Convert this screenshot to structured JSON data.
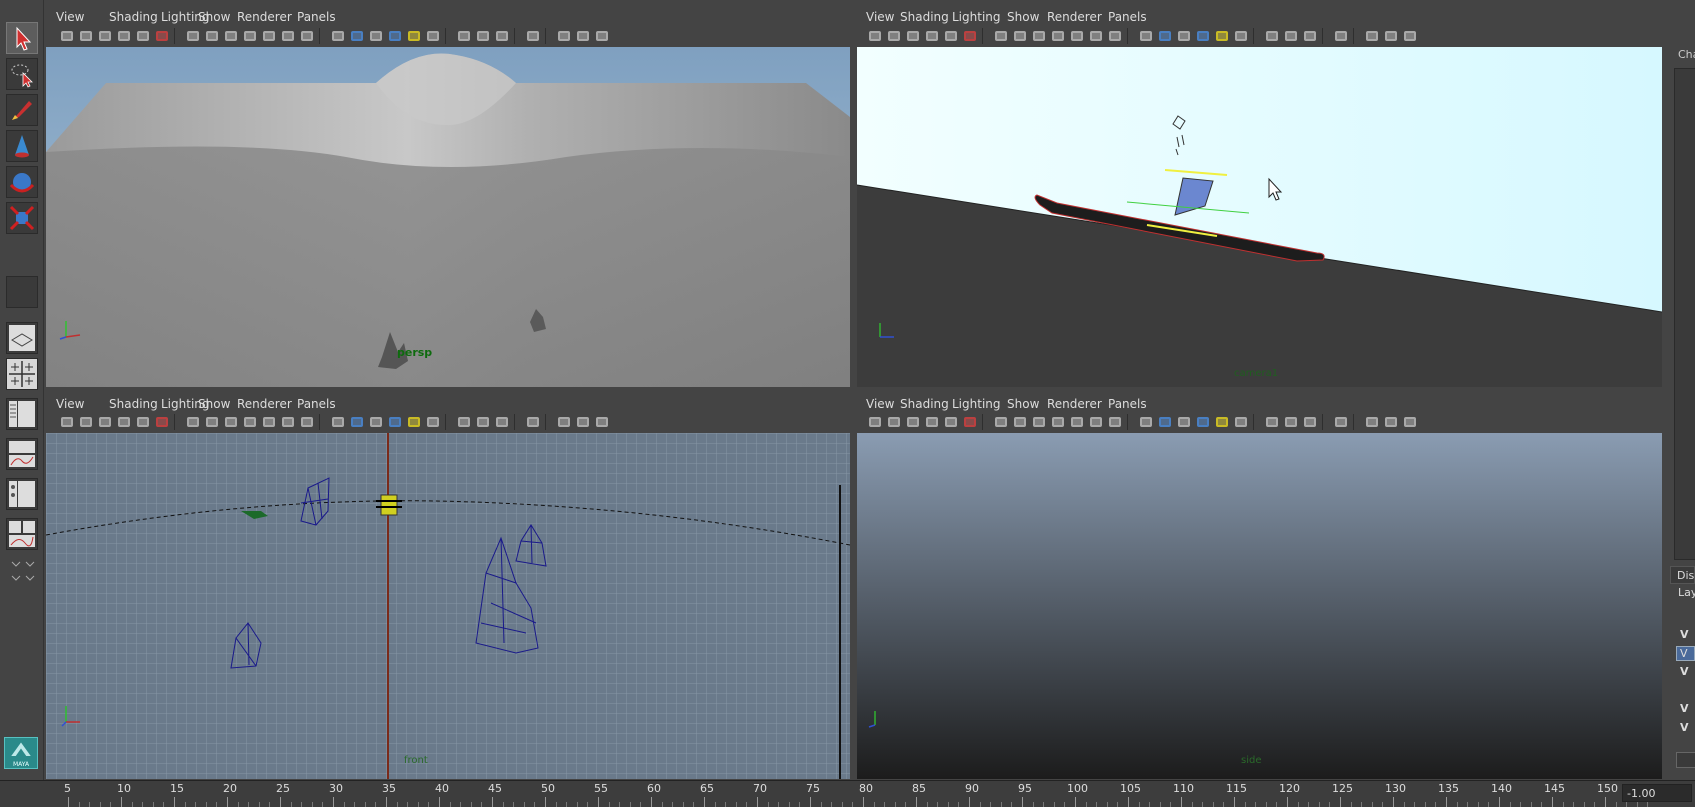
{
  "menus": [
    "View",
    "Shading",
    "Lighting",
    "Show",
    "Renderer",
    "Panels"
  ],
  "viewports": {
    "top_left": {
      "label": "persp",
      "label_color": "#1a6a1a"
    },
    "top_right": {
      "label": "camera1",
      "label_color": "#1f5f1f"
    },
    "bottom_left": {
      "label": "front",
      "label_color": "#2a6a2a"
    },
    "bottom_right": {
      "label": "side",
      "label_color": "#2a6a2a"
    }
  },
  "axis_letters": {
    "x": "x",
    "y": "y",
    "z": "z"
  },
  "right_panel": {
    "top_tab": "Cha",
    "tab2": "Dis",
    "layer_label": "Lay",
    "layer_rows": [
      "V",
      "V",
      "V",
      "V",
      "V"
    ]
  },
  "timeline": {
    "ticks": [
      5,
      10,
      15,
      20,
      25,
      30,
      35,
      40,
      45,
      50,
      55,
      60,
      65,
      70,
      75,
      80,
      85,
      90,
      95,
      100,
      105,
      110,
      115,
      120,
      125,
      130,
      135,
      140,
      145,
      150
    ],
    "current_frame": 38,
    "field_value": "-1.00"
  },
  "logo_text": "MAYA",
  "colors": {
    "accent": "#57c1c1",
    "wire": "#1a1a8a",
    "grid_bg": "#6f7f8f"
  }
}
